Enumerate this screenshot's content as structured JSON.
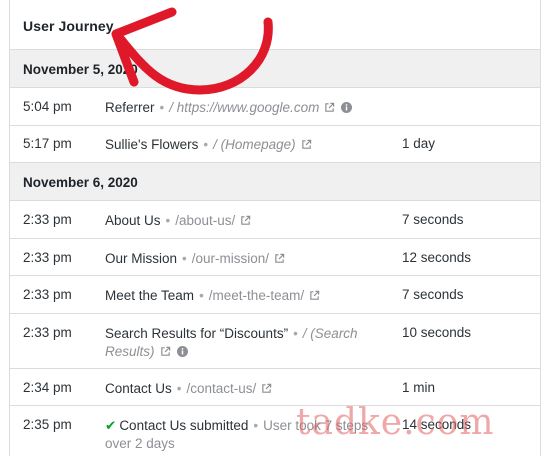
{
  "header": {
    "title": "User Journey"
  },
  "groups": [
    {
      "date": "November 5, 2020",
      "rows": [
        {
          "time": "5:04 pm",
          "title": "Referrer",
          "path": "/ https://www.google.com",
          "duration": ""
        },
        {
          "time": "5:17 pm",
          "title": "Sullie's Flowers",
          "path": "/ (Homepage)",
          "duration": "1 day"
        }
      ]
    },
    {
      "date": "November 6, 2020",
      "rows": [
        {
          "time": "2:33 pm",
          "title": "About Us",
          "path": "/about-us/",
          "duration": "7 seconds"
        },
        {
          "time": "2:33 pm",
          "title": "Our Mission",
          "path": "/our-mission/",
          "duration": "12 seconds"
        },
        {
          "time": "2:33 pm",
          "title": "Meet the Team",
          "path": "/meet-the-team/",
          "duration": "7 seconds"
        },
        {
          "time": "2:33 pm",
          "title": "Search Results for “Discounts”",
          "path_line1": "/ (Search",
          "path_line2": "Results)",
          "duration": "10 seconds"
        },
        {
          "time": "2:34 pm",
          "title": "Contact Us",
          "path": "/contact-us/",
          "duration": "1 min"
        },
        {
          "time": "2:35 pm",
          "title": "Contact Us submitted",
          "note_line1": "User took 7 steps",
          "note_line2": "over 2 days",
          "duration": "14 seconds"
        }
      ]
    }
  ],
  "separator": "•",
  "watermark": "tadke.com",
  "colors": {
    "annotation_arrow": "#e0192a",
    "check": "#00a32a",
    "border": "#dcdcde",
    "date_bg": "#f0f0f1"
  },
  "icons": [
    "external-link-icon",
    "info-icon",
    "checkmark-icon",
    "annotation-arrow"
  ]
}
